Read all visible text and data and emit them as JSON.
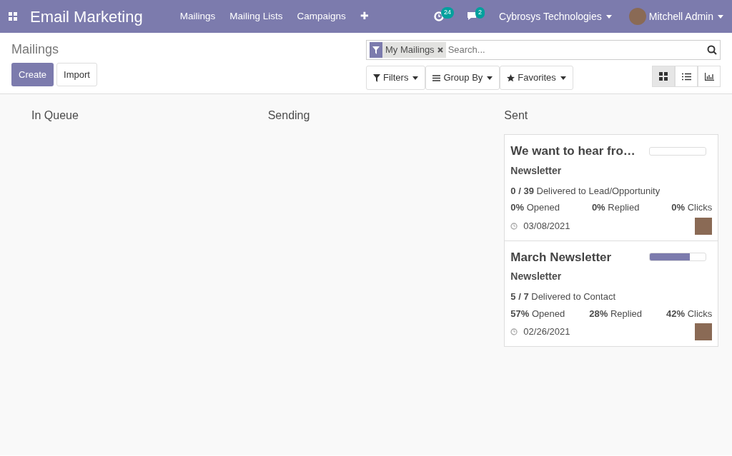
{
  "navbar": {
    "app_title": "Email Marketing",
    "menu": [
      "Mailings",
      "Mailing Lists",
      "Campaigns"
    ],
    "plus": "✚",
    "activity_count": "24",
    "message_count": "2",
    "company": "Cybrosys Technologies",
    "user": "Mitchell Admin"
  },
  "control_panel": {
    "breadcrumb": "Mailings",
    "buttons": [
      "Create",
      "Import"
    ],
    "facet": "My Mailings",
    "search": {
      "placeholder": "Search..."
    },
    "filters": [
      "Filters",
      "Group By",
      "Favorites"
    ],
    "views": [
      {
        "kind": "kanban",
        "selected": true
      },
      {
        "kind": "list",
        "selected": false
      },
      {
        "kind": "graph",
        "selected": false
      }
    ]
  },
  "columns": [
    {
      "title": "In Queue"
    },
    {
      "title": "Sending"
    },
    {
      "title": "Sent",
      "cards": [
        {
          "title": "We want to hear fro…",
          "level": 0,
          "mailing_list": "Newsletter",
          "delivered": "**0 / 39** Delivered to Lead/Opportunity",
          "opened": "**0%** Opened",
          "replied": "**0%** Replied",
          "clicks": "**0%** Clicks",
          "date": "03/08/2021"
        },
        {
          "title": "March Newsletter",
          "level": 0.71,
          "mailing_list": "Newsletter",
          "delivered": "**5 / 7** Delivered to Contact",
          "opened": "**57%** Opened",
          "replied": "**28%** Replied",
          "clicks": "**42%** Clicks",
          "date": "02/26/2021"
        }
      ]
    }
  ]
}
